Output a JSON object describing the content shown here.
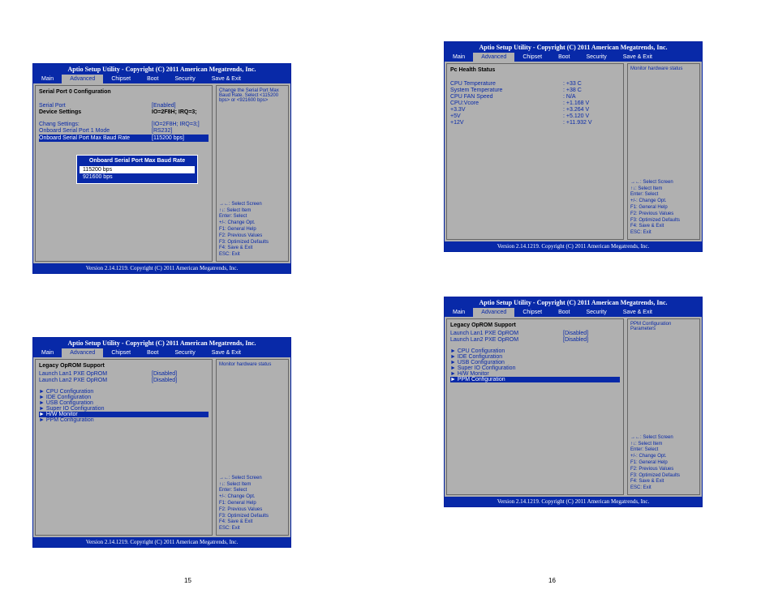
{
  "title": "Aptio Setup Utility - Copyright (C) 2011 American Megatrends, Inc.",
  "footer": "Version 2.14.1219. Copyright (C) 2011 American Megatrends, Inc.",
  "tabs": [
    "Main",
    "Advanced",
    "Chipset",
    "Boot",
    "Security",
    "Save & Exit"
  ],
  "helpKeys": {
    "l1": "→←: Select Screen",
    "l2": "↑↓: Select Item",
    "l3": "Enter: Select",
    "l4": "+/-: Change Opt.",
    "l5": "F1: General Help",
    "l6": "F2: Previous Values",
    "l7": "F3: Optimized Defaults",
    "l8": "F4: Save & Exit",
    "l9": "ESC: Exit"
  },
  "panel1": {
    "heading": "Serial Port 0 Configuration",
    "help": "Change the Serial Port Max Baud Rate. Select <115200 bps> or <921600 bps>",
    "rows": {
      "r1l": "Serial Port",
      "r1v": "[Enabled]",
      "r2l": "Device Settings",
      "r2v": "IO=2F8H;  IRQ=3;",
      "r3l": "Chang Settings:",
      "r3v": "[IO=2F8H;  IRQ=3;]",
      "r4l": "Onboard Serial Port 1 Mode",
      "r4v": "[RS232]",
      "r5l": "Onboard Serial Port Max Baud Rate",
      "r5v": "[115200    bps]"
    },
    "popup": {
      "title": "Onboard Serial Port Max Baud Rate",
      "opt1": "115200   bps",
      "opt2": "921600   bps"
    }
  },
  "panel2": {
    "heading": "Pc Health Status",
    "help": "Monitor hardware status",
    "rows": {
      "r1l": "CPU Temperature",
      "r1v": ": +33 C",
      "r2l": "System Temperature",
      "r2v": ": +38 C",
      "r3l": "CPU FAN Speed",
      "r3v": ": N/A",
      "r4l": "CPU:Vcore",
      "r4v": ": +1.168 V",
      "r5l": "+3.3V",
      "r5v": ": +3.264 V",
      "r6l": "+5V",
      "r6v": ": +5.120 V",
      "r7l": "+12V",
      "r7v": ": +11.932 V"
    }
  },
  "panel3": {
    "heading": "Legacy OpROM Support",
    "help": "Monitor hardware status",
    "rows": {
      "r1l": "Launch Lan1 PXE OpROM",
      "r1v": "[Disabled]",
      "r2l": "Launch Lan2 PXE OpROM",
      "r2v": "[Disabled]"
    },
    "menus": {
      "m1": "CPU Configuration",
      "m2": "IDE  Configuration",
      "m3": "USB Configuration",
      "m4": "Super IO Configuration",
      "m5": "H/W Monitor",
      "m6": "PPM Configuration"
    }
  },
  "panel4": {
    "heading": "Legacy OpROM Support",
    "help": "PPM Configuration Parameters",
    "rows": {
      "r1l": "Launch Lan1 PXE OpROM",
      "r1v": "[Disabled]",
      "r2l": "Launch Lan2 PXE OpROM",
      "r2v": "[Disabled]"
    },
    "menus": {
      "m1": "CPU Configuration",
      "m2": "IDE  Configuration",
      "m3": "USB Configuration",
      "m4": "Super IO Configuration",
      "m5": "H/W Monitor",
      "m6": "PPM Configuration"
    }
  },
  "pageLeft": "15",
  "pageRight": "16"
}
